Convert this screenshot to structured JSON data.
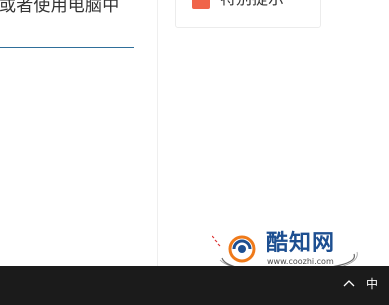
{
  "article": {
    "text_line": "或者使用电脑中"
  },
  "sidebar": {
    "tip_card": {
      "label": "特别提示",
      "icon": "tip-icon",
      "icon_color": "#f0654a"
    }
  },
  "watermark": {
    "brand": "酷知网",
    "url": "www.coozhi.com"
  },
  "taskbar": {
    "tray_icon": "chevron-up-icon",
    "ime_label": "中",
    "background": "#1b1b1b"
  }
}
